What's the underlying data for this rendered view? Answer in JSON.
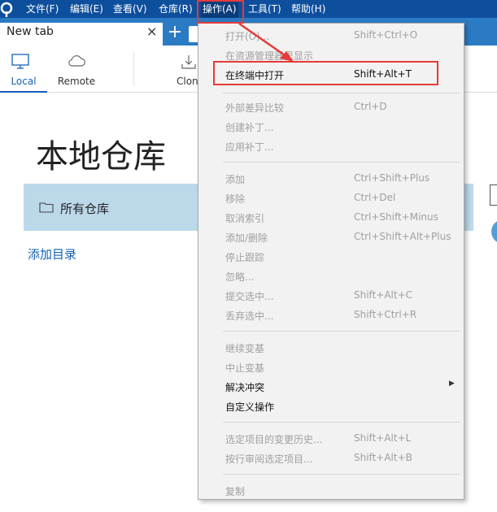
{
  "menubar": {
    "items": [
      {
        "label": "文件(F)"
      },
      {
        "label": "编辑(E)"
      },
      {
        "label": "查看(V)"
      },
      {
        "label": "仓库(R)"
      },
      {
        "label": "操作(A)"
      },
      {
        "label": "工具(T)"
      },
      {
        "label": "帮助(H)"
      }
    ],
    "active_index": 4
  },
  "tabs": {
    "items": [
      {
        "title": "New tab",
        "close": "×"
      }
    ],
    "add": "+"
  },
  "toolbar": {
    "local_label": "Local",
    "remote_label": "Remote",
    "clone_label": "Clon"
  },
  "main": {
    "title": "本地仓库",
    "all_repos_label": "所有仓库",
    "add_dir_label": "添加目录"
  },
  "dropdown": {
    "items": [
      {
        "label": "打开(O)...",
        "shortcut": "Shift+Ctrl+O",
        "enabled": false
      },
      {
        "label": "在资源管理器里显示",
        "shortcut": "",
        "enabled": false
      },
      {
        "label": "在终端中打开",
        "shortcut": "Shift+Alt+T",
        "enabled": true
      },
      {
        "label": "外部差异比较",
        "shortcut": "Ctrl+D",
        "enabled": false
      },
      {
        "label": "创建补丁...",
        "shortcut": "",
        "enabled": false
      },
      {
        "label": "应用补丁...",
        "shortcut": "",
        "enabled": false
      },
      {
        "label": "添加",
        "shortcut": "Ctrl+Shift+Plus",
        "enabled": false
      },
      {
        "label": "移除",
        "shortcut": "Ctrl+Del",
        "enabled": false
      },
      {
        "label": "取消索引",
        "shortcut": "Ctrl+Shift+Minus",
        "enabled": false
      },
      {
        "label": "添加/删除",
        "shortcut": "Ctrl+Shift+Alt+Plus",
        "enabled": false
      },
      {
        "label": "停止跟踪",
        "shortcut": "",
        "enabled": false
      },
      {
        "label": "忽略...",
        "shortcut": "",
        "enabled": false
      },
      {
        "label": "提交选中...",
        "shortcut": "Shift+Alt+C",
        "enabled": false
      },
      {
        "label": "丢弃选中...",
        "shortcut": "Shift+Ctrl+R",
        "enabled": false
      },
      {
        "label": "继续变基",
        "shortcut": "",
        "enabled": false
      },
      {
        "label": "中止变基",
        "shortcut": "",
        "enabled": false
      },
      {
        "label": "解决冲突",
        "shortcut": "",
        "enabled": true,
        "submenu": true
      },
      {
        "label": "自定义操作",
        "shortcut": "",
        "enabled": true
      },
      {
        "label": "选定项目的变更历史...",
        "shortcut": "Shift+Alt+L",
        "enabled": false
      },
      {
        "label": "按行审阅选定项目...",
        "shortcut": "Shift+Alt+B",
        "enabled": false
      },
      {
        "label": "复制",
        "shortcut": "",
        "enabled": false
      }
    ]
  },
  "colors": {
    "menubar_bg": "#0e4f9d",
    "tabbar_bg": "#2b7bc4",
    "accent": "#1560b5",
    "highlight_row_bg": "#bcd9ea",
    "annotation_red": "#e63a3a"
  },
  "icons": {
    "app_logo": "sourcetree-logo-icon",
    "local": "monitor-icon",
    "remote": "cloud-icon",
    "clone": "download-icon",
    "folder": "folder-icon",
    "submenu": "triangle-right-icon"
  }
}
